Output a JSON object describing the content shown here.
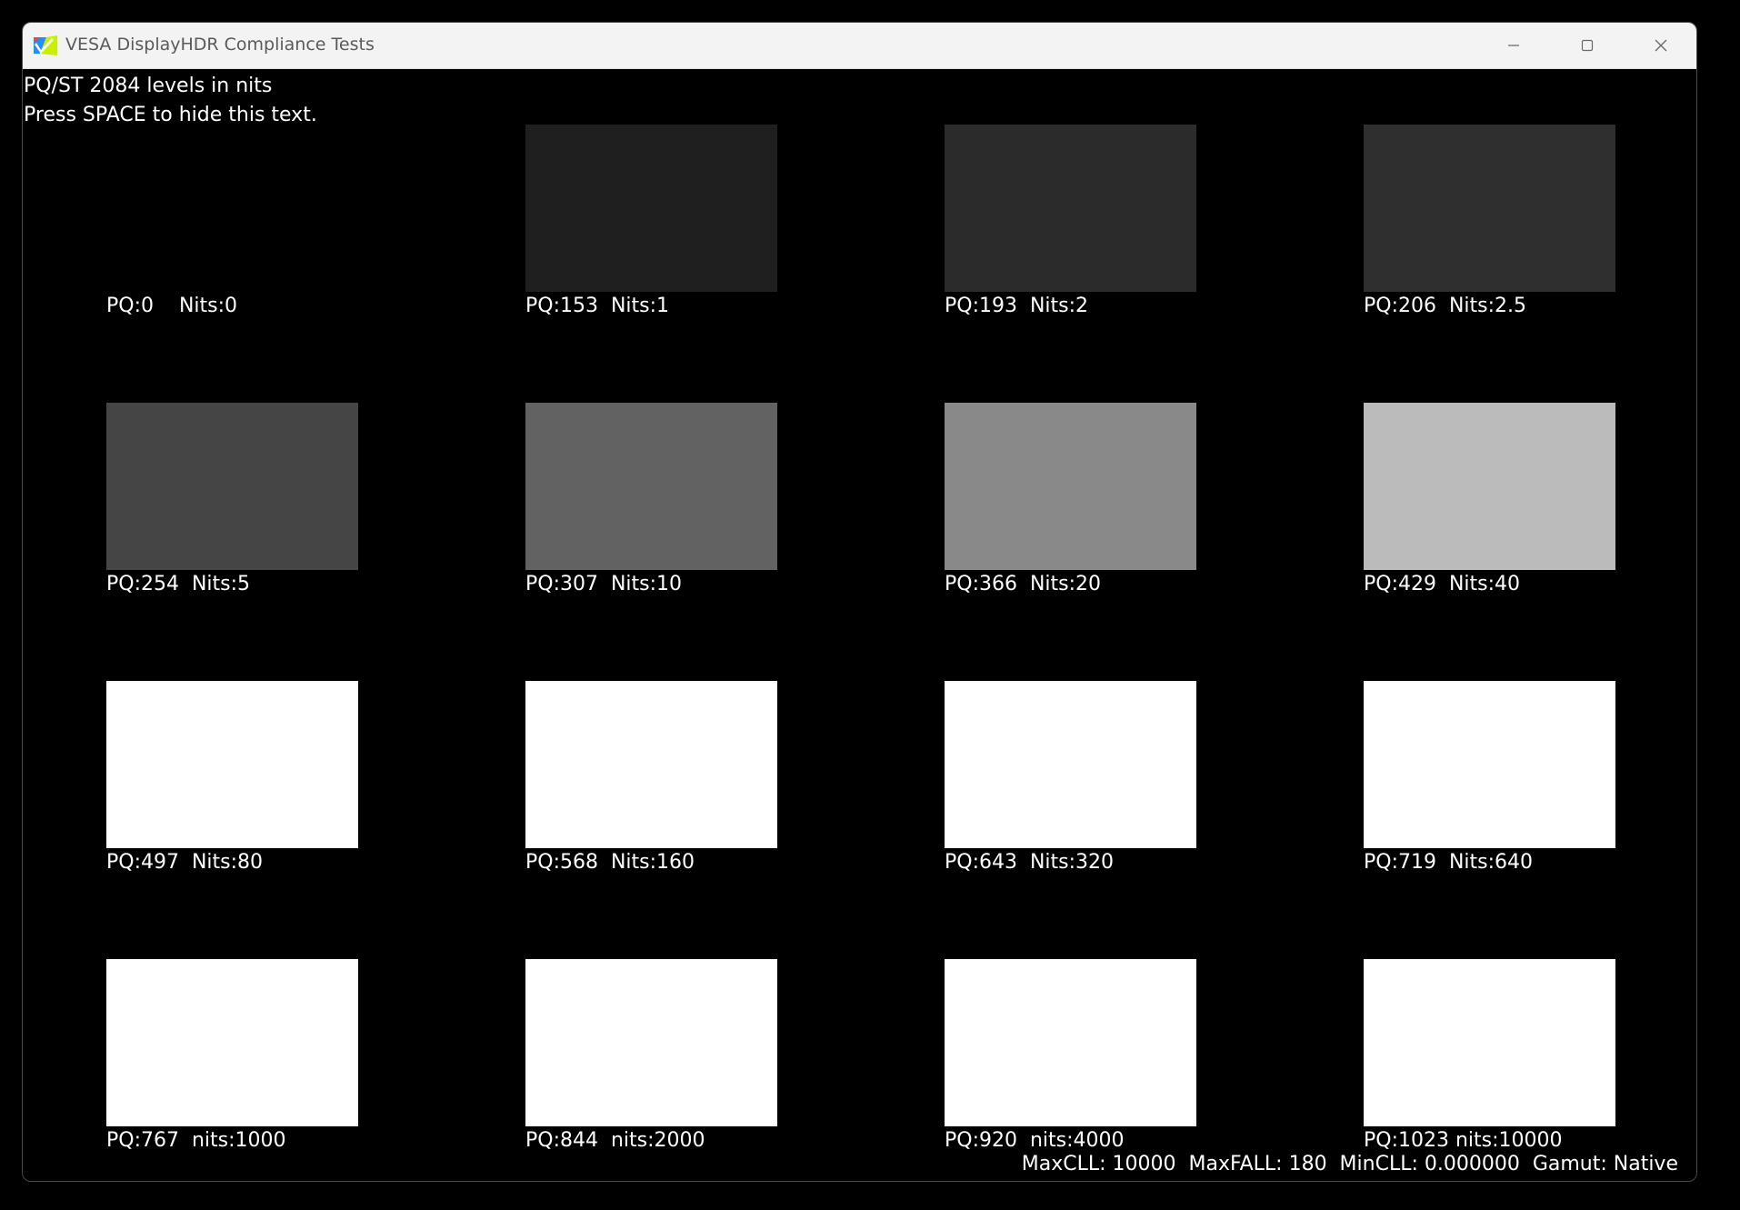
{
  "window": {
    "title": "VESA DisplayHDR Compliance Tests"
  },
  "info": {
    "line1": "PQ/ST 2084 levels in nits",
    "line2": "Press SPACE to hide this text."
  },
  "tiles": [
    {
      "label": "PQ:0    Nits:0",
      "color": "#000000"
    },
    {
      "label": "PQ:153  Nits:1",
      "color": "#1f1f1f"
    },
    {
      "label": "PQ:193  Nits:2",
      "color": "#2b2b2b"
    },
    {
      "label": "PQ:206  Nits:2.5",
      "color": "#2f2f2f"
    },
    {
      "label": "PQ:254  Nits:5",
      "color": "#454545"
    },
    {
      "label": "PQ:307  Nits:10",
      "color": "#626262"
    },
    {
      "label": "PQ:366  Nits:20",
      "color": "#898989"
    },
    {
      "label": "PQ:429  Nits:40",
      "color": "#bbbbbb"
    },
    {
      "label": "PQ:497  Nits:80",
      "color": "#ffffff"
    },
    {
      "label": "PQ:568  Nits:160",
      "color": "#ffffff"
    },
    {
      "label": "PQ:643  Nits:320",
      "color": "#ffffff"
    },
    {
      "label": "PQ:719  Nits:640",
      "color": "#ffffff"
    },
    {
      "label": "PQ:767  nits:1000",
      "color": "#ffffff"
    },
    {
      "label": "PQ:844  nits:2000",
      "color": "#ffffff"
    },
    {
      "label": "PQ:920  nits:4000",
      "color": "#ffffff"
    },
    {
      "label": "PQ:1023 nits:10000",
      "color": "#ffffff"
    }
  ],
  "footer": {
    "text": "MaxCLL: 10000  MaxFALL: 180  MinCLL: 0.000000  Gamut: Native"
  }
}
